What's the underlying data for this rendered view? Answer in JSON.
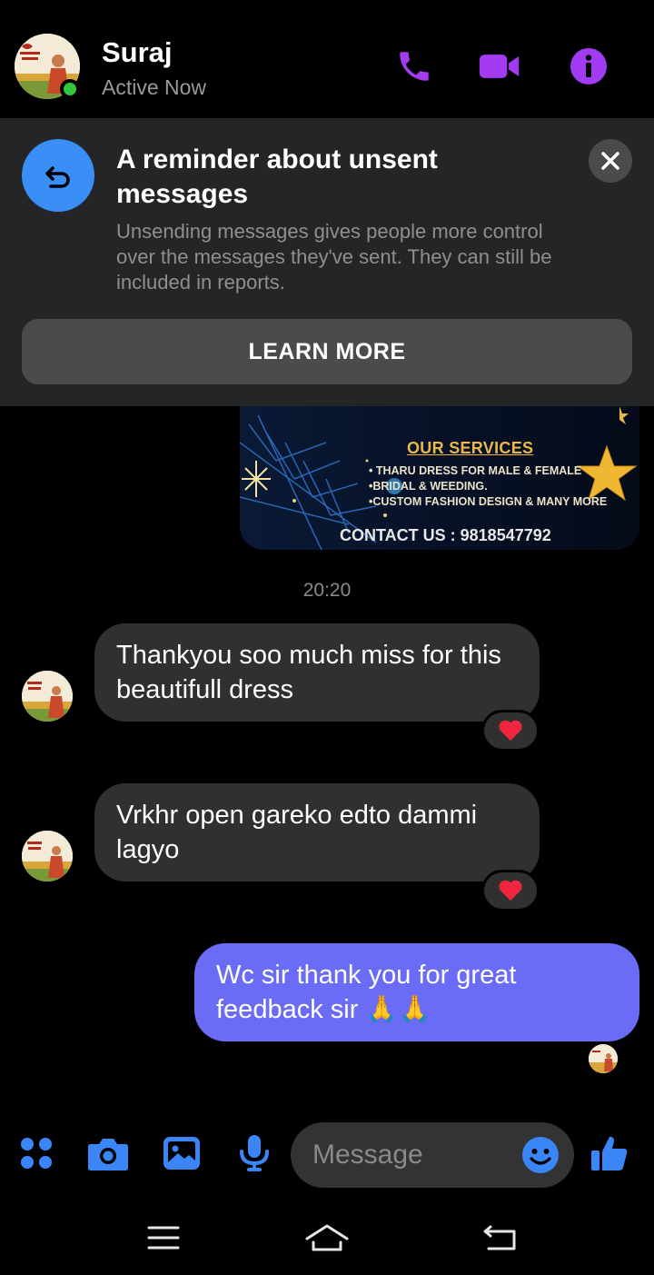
{
  "header": {
    "contact_name": "Suraj",
    "status": "Active Now",
    "icons": [
      "phone-icon",
      "video-camera-icon",
      "info-icon"
    ],
    "accent_color": "#a33bf3"
  },
  "banner": {
    "title": "A reminder about unsent messages",
    "body": "Unsending messages gives people more control over the messages they've sent. They can still be included in reports.",
    "button_label": "LEARN MORE"
  },
  "image_card": {
    "heading": "OUR SERVICES",
    "services": [
      "• THARU DRESS FOR MALE & FEMALE",
      "•BRIDAL & WEEDING.",
      "•CUSTOM FASHION DESIGN & MANY MORE"
    ],
    "contact": "CONTACT US : 9818547792"
  },
  "timestamp": "20:20",
  "messages": [
    {
      "direction": "incoming",
      "text": "Thankyou soo much miss for this beautifull dress",
      "reaction": "heart"
    },
    {
      "direction": "incoming",
      "text": "Vrkhr open gareko edto dammi lagyo",
      "reaction": "heart"
    },
    {
      "direction": "outgoing",
      "text": "Wc sir thank you for great feedback sir 🙏🙏"
    }
  ],
  "composer": {
    "placeholder": "Message",
    "icons": [
      "apps-grid-icon",
      "camera-icon",
      "gallery-icon",
      "microphone-icon",
      "emoji-icon",
      "thumbs-up-icon"
    ],
    "accent_color": "#3b86f6"
  },
  "colors": {
    "outgoing_bubble": "#6b6cf6",
    "incoming_bubble": "#303030",
    "banner_bg": "#242526"
  }
}
